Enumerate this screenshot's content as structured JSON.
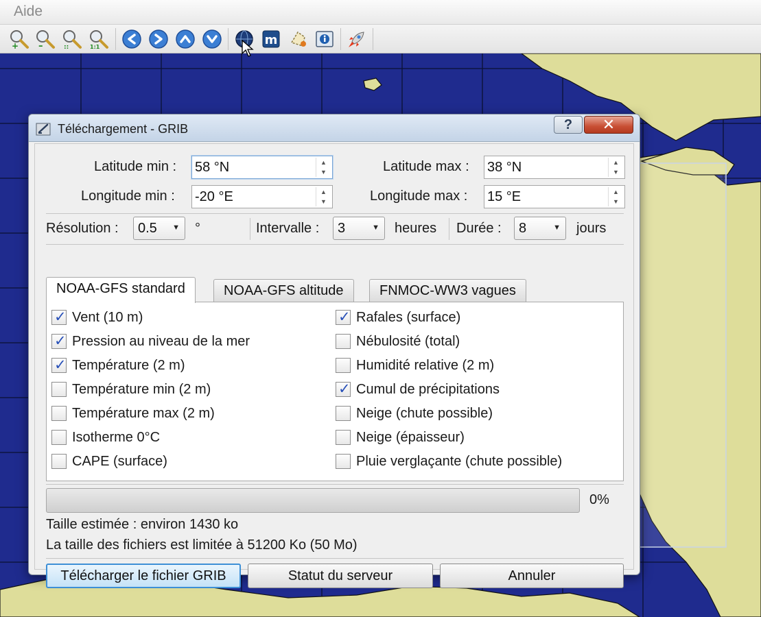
{
  "menubar": {
    "items": [
      "Aide"
    ]
  },
  "toolbar": {
    "buttons": [
      "zoom-in-icon",
      "zoom-out-icon",
      "zoom-fit-icon",
      "zoom-one-to-one-icon",
      "arrow-left-icon",
      "arrow-right-icon",
      "arrow-up-icon",
      "arrow-down-icon",
      "globe-icon",
      "m-icon",
      "selection-icon",
      "info-icon",
      "rocket-icon"
    ],
    "zoom_fit_badge": "::",
    "zoom_one_badge": "1:1",
    "m_letter": "m"
  },
  "dialog": {
    "title": "Téléchargement - GRIB",
    "help_label": "?",
    "close_label": "✕",
    "lat_min_label": "Latitude min :",
    "lat_min_value": "58 °N",
    "lat_max_label": "Latitude max :",
    "lat_max_value": "38 °N",
    "lon_min_label": "Longitude min :",
    "lon_min_value": "-20 °E",
    "lon_max_label": "Longitude max :",
    "lon_max_value": "15 °E",
    "resolution_label": "Résolution :",
    "resolution_value": "0.5",
    "resolution_unit": "°",
    "interval_label": "Intervalle :",
    "interval_value": "3",
    "interval_unit": "heures",
    "duration_label": "Durée :",
    "duration_value": "8",
    "duration_unit": "jours",
    "tabs": [
      "NOAA-GFS standard",
      "NOAA-GFS altitude",
      "FNMOC-WW3 vagues"
    ],
    "options_left": [
      {
        "label": "Vent (10 m)",
        "checked": true
      },
      {
        "label": "Pression au niveau de la mer",
        "checked": true
      },
      {
        "label": "Température (2 m)",
        "checked": true
      },
      {
        "label": "Température min (2 m)",
        "checked": false
      },
      {
        "label": "Température max (2 m)",
        "checked": false
      },
      {
        "label": "Isotherme 0°C",
        "checked": false
      },
      {
        "label": "CAPE (surface)",
        "checked": false
      }
    ],
    "options_right": [
      {
        "label": "Rafales (surface)",
        "checked": true
      },
      {
        "label": "Nébulosité (total)",
        "checked": false
      },
      {
        "label": "Humidité relative (2 m)",
        "checked": false
      },
      {
        "label": "Cumul de précipitations",
        "checked": true
      },
      {
        "label": "Neige (chute possible)",
        "checked": false
      },
      {
        "label": "Neige (épaisseur)",
        "checked": false
      },
      {
        "label": "Pluie verglaçante (chute possible)",
        "checked": false
      }
    ],
    "progress_fraction": 0,
    "progress_text": "0%",
    "estimated_size": "Taille estimée : environ 1430 ko",
    "size_limit": "La taille des fichiers est limitée à 51200 Ko (50 Mo)",
    "download_button": "Télécharger le fichier GRIB",
    "server_status_button": "Statut du serveur",
    "cancel_button": "Annuler"
  },
  "colors": {
    "sea": "#1f2b8e",
    "land": "#dedd9a",
    "accent": "#3d8fd6",
    "check": "#2850b8"
  }
}
